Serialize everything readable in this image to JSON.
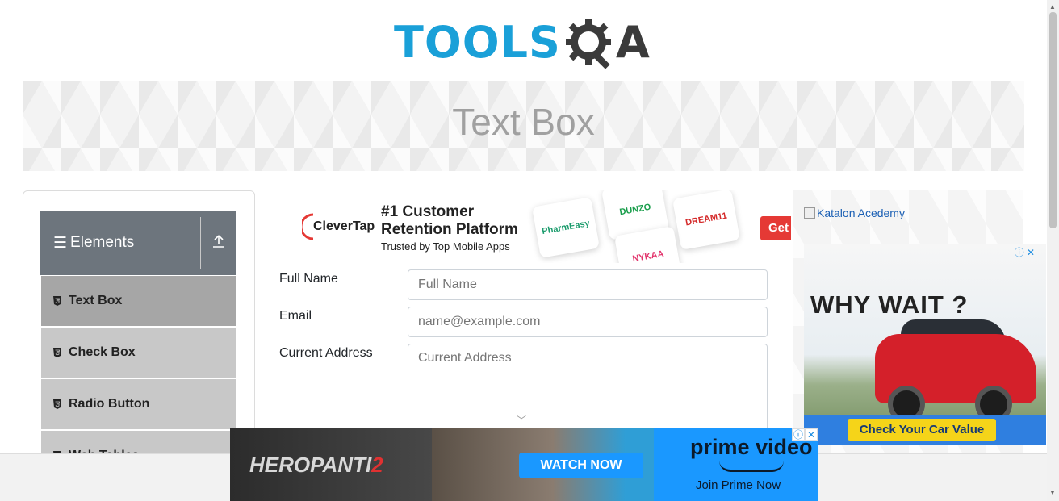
{
  "header": {
    "logo_text": "TOOLS",
    "logo_suffix": "A",
    "logo_alt": "ToolsQA"
  },
  "banner": {
    "title": "Text Box"
  },
  "sidebar": {
    "group_title": "Elements",
    "items": [
      {
        "label": "Text Box",
        "active": true
      },
      {
        "label": "Check Box"
      },
      {
        "label": "Radio Button"
      },
      {
        "label": "Web Tables"
      }
    ]
  },
  "ad_top": {
    "brand": "CleverTap",
    "headline_line1": "#1 Customer",
    "headline_line2": "Retention Platform",
    "subline": "Trusted by Top Mobile Apps",
    "tiles": [
      "PharmEasy",
      "DUNZO",
      "DREAM11",
      "NYKAA"
    ],
    "cta": "Get"
  },
  "form": {
    "full_name_label": "Full Name",
    "full_name_placeholder": "Full Name",
    "email_label": "Email",
    "email_placeholder": "name@example.com",
    "address_label": "Current Address",
    "address_placeholder": "Current Address"
  },
  "ad_right": {
    "link_text": "Katalon Acedemy",
    "headline": "WHY WAIT ?",
    "cta": "Check Your Car Value"
  },
  "ad_bottom": {
    "title_main": "HEROPANTI",
    "title_num": "2",
    "watch": "WATCH NOW",
    "brand": "prime video",
    "join": "Join Prime Now"
  },
  "colors": {
    "accent": "#1aa0d8",
    "sidebar_header": "#6d757d",
    "menu_item": "#c8c8c8",
    "menu_active": "#a6a6a6"
  }
}
